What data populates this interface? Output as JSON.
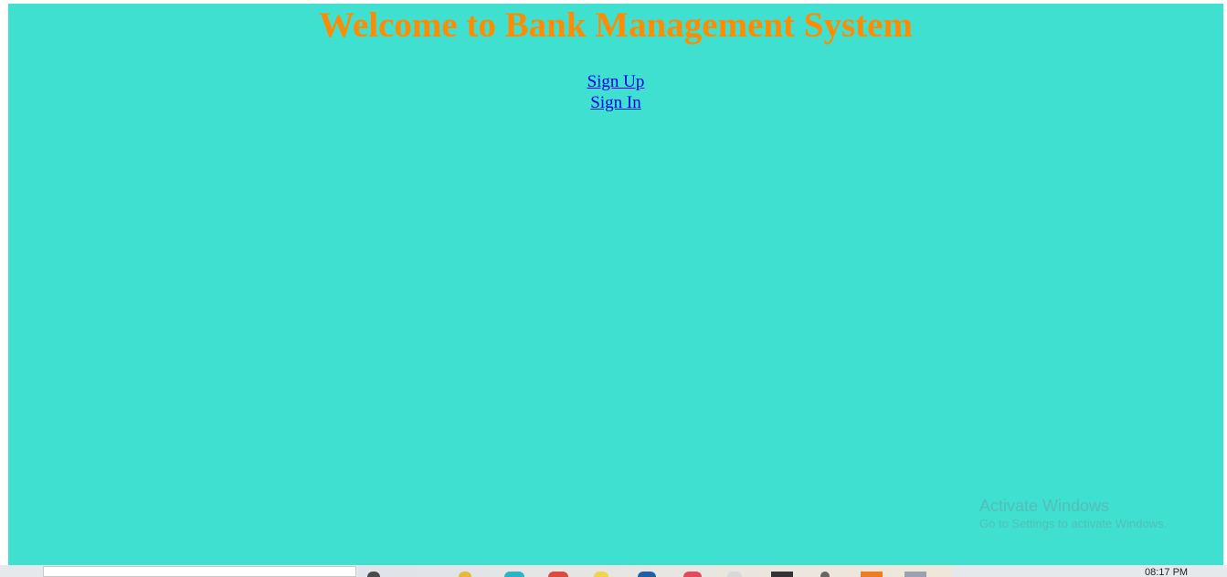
{
  "page": {
    "title": "Welcome to Bank Management System",
    "links": {
      "sign_up": "Sign Up",
      "sign_in": "Sign In"
    }
  },
  "watermark": {
    "title": "Activate Windows",
    "subtitle": "Go to Settings to activate Windows."
  },
  "taskbar": {
    "clock": "08:17 PM",
    "icons": [
      "cortana-icon",
      "file-explorer-icon",
      "edge-icon",
      "chrome-icon",
      "sticky-notes-icon",
      "virtualbox-icon",
      "opera-icon",
      "notepad-icon",
      "terminal-icon",
      "app-icon",
      "sublime-icon",
      "window-icon"
    ]
  },
  "colors": {
    "background": "#40E0D0",
    "title": "#FF8C00",
    "link": "#0000EE"
  }
}
